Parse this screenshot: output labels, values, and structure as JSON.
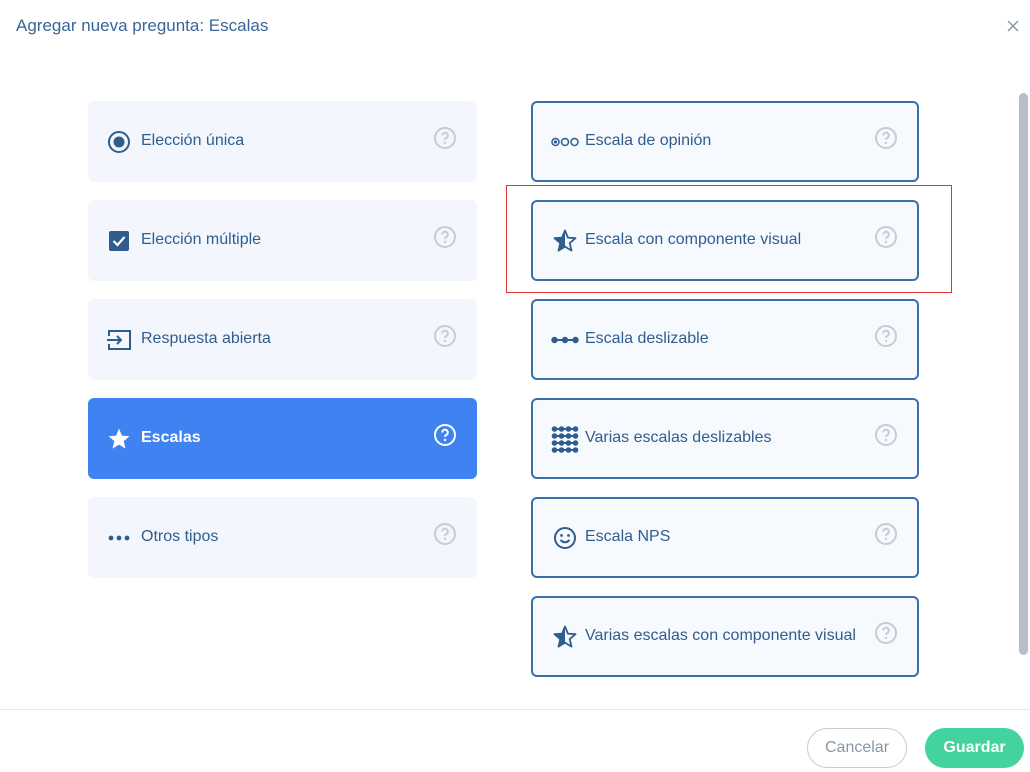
{
  "dialog": {
    "title": "Agregar nueva pregunta: Escalas",
    "close_icon": "close-icon"
  },
  "categories": [
    {
      "label": "Elección única",
      "icon": "radio-selected-icon",
      "selected": false
    },
    {
      "label": "Elección múltiple",
      "icon": "checkbox-checked-icon",
      "selected": false
    },
    {
      "label": "Respuesta abierta",
      "icon": "text-entry-icon",
      "selected": false
    },
    {
      "label": "Escalas",
      "icon": "star-icon",
      "selected": true
    },
    {
      "label": "Otros tipos",
      "icon": "more-dots-icon",
      "selected": false
    }
  ],
  "question_types": [
    {
      "label": "Escala de opinión",
      "icon": "opinion-scale-icon"
    },
    {
      "label": "Escala con componente visual",
      "icon": "star-outline-icon"
    },
    {
      "label": "Escala deslizable",
      "icon": "slider-dots-icon"
    },
    {
      "label": "Varias escalas deslizables",
      "icon": "multi-slider-icon"
    },
    {
      "label": "Escala NPS",
      "icon": "smiley-icon"
    },
    {
      "label": "Varias escalas con componente visual",
      "icon": "star-outline-icon"
    }
  ],
  "footer": {
    "cancel_label": "Cancelar",
    "save_label": "Guardar"
  },
  "colors": {
    "accent": "#3f82f2",
    "text": "#2f5d8e",
    "save": "#43d39e",
    "highlight": "#e0333a"
  }
}
